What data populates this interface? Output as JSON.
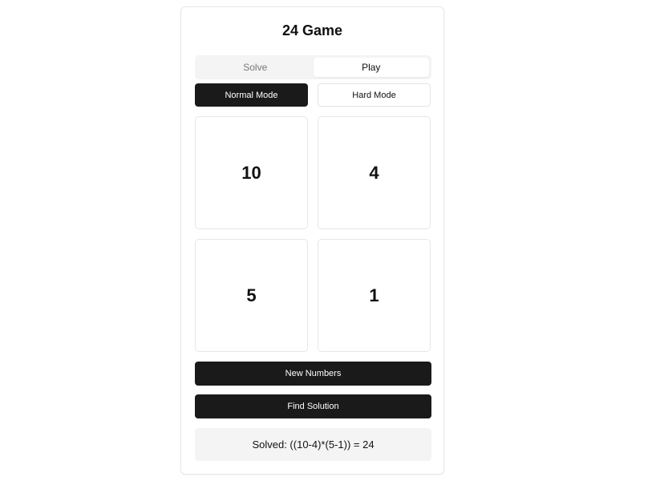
{
  "app": {
    "title": "24 Game"
  },
  "tabs": [
    {
      "label": "Solve",
      "active": false
    },
    {
      "label": "Play",
      "active": true
    }
  ],
  "modes": [
    {
      "label": "Normal Mode",
      "selected": true
    },
    {
      "label": "Hard Mode",
      "selected": false
    }
  ],
  "numbers": [
    "10",
    "4",
    "5",
    "1"
  ],
  "actions": {
    "new_numbers": "New Numbers",
    "find_solution": "Find Solution"
  },
  "result": {
    "text": "Solved: ((10-4)*(5-1)) = 24"
  },
  "colors": {
    "primary": "#1a1a1a",
    "surface": "#f4f4f4",
    "border": "#e6e6e6"
  }
}
